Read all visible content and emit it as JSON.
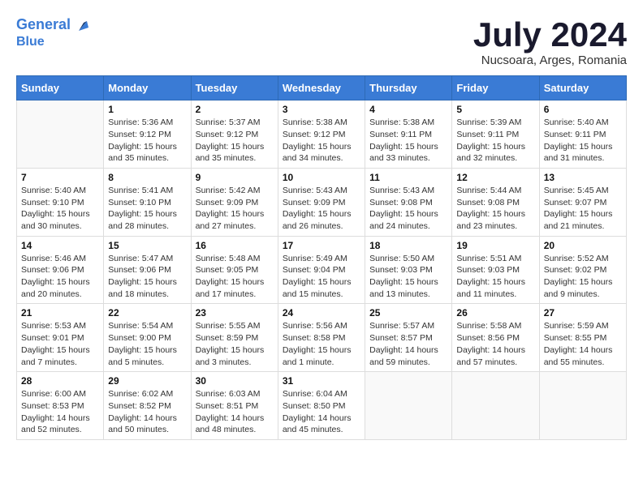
{
  "logo": {
    "line1": "General",
    "line2": "Blue"
  },
  "title": "July 2024",
  "subtitle": "Nucsoara, Arges, Romania",
  "days": [
    "Sunday",
    "Monday",
    "Tuesday",
    "Wednesday",
    "Thursday",
    "Friday",
    "Saturday"
  ],
  "weeks": [
    [
      {
        "day": "",
        "sunrise": "",
        "sunset": "",
        "daylight": ""
      },
      {
        "day": "1",
        "sunrise": "Sunrise: 5:36 AM",
        "sunset": "Sunset: 9:12 PM",
        "daylight": "Daylight: 15 hours and 35 minutes."
      },
      {
        "day": "2",
        "sunrise": "Sunrise: 5:37 AM",
        "sunset": "Sunset: 9:12 PM",
        "daylight": "Daylight: 15 hours and 35 minutes."
      },
      {
        "day": "3",
        "sunrise": "Sunrise: 5:38 AM",
        "sunset": "Sunset: 9:12 PM",
        "daylight": "Daylight: 15 hours and 34 minutes."
      },
      {
        "day": "4",
        "sunrise": "Sunrise: 5:38 AM",
        "sunset": "Sunset: 9:11 PM",
        "daylight": "Daylight: 15 hours and 33 minutes."
      },
      {
        "day": "5",
        "sunrise": "Sunrise: 5:39 AM",
        "sunset": "Sunset: 9:11 PM",
        "daylight": "Daylight: 15 hours and 32 minutes."
      },
      {
        "day": "6",
        "sunrise": "Sunrise: 5:40 AM",
        "sunset": "Sunset: 9:11 PM",
        "daylight": "Daylight: 15 hours and 31 minutes."
      }
    ],
    [
      {
        "day": "7",
        "sunrise": "Sunrise: 5:40 AM",
        "sunset": "Sunset: 9:10 PM",
        "daylight": "Daylight: 15 hours and 30 minutes."
      },
      {
        "day": "8",
        "sunrise": "Sunrise: 5:41 AM",
        "sunset": "Sunset: 9:10 PM",
        "daylight": "Daylight: 15 hours and 28 minutes."
      },
      {
        "day": "9",
        "sunrise": "Sunrise: 5:42 AM",
        "sunset": "Sunset: 9:09 PM",
        "daylight": "Daylight: 15 hours and 27 minutes."
      },
      {
        "day": "10",
        "sunrise": "Sunrise: 5:43 AM",
        "sunset": "Sunset: 9:09 PM",
        "daylight": "Daylight: 15 hours and 26 minutes."
      },
      {
        "day": "11",
        "sunrise": "Sunrise: 5:43 AM",
        "sunset": "Sunset: 9:08 PM",
        "daylight": "Daylight: 15 hours and 24 minutes."
      },
      {
        "day": "12",
        "sunrise": "Sunrise: 5:44 AM",
        "sunset": "Sunset: 9:08 PM",
        "daylight": "Daylight: 15 hours and 23 minutes."
      },
      {
        "day": "13",
        "sunrise": "Sunrise: 5:45 AM",
        "sunset": "Sunset: 9:07 PM",
        "daylight": "Daylight: 15 hours and 21 minutes."
      }
    ],
    [
      {
        "day": "14",
        "sunrise": "Sunrise: 5:46 AM",
        "sunset": "Sunset: 9:06 PM",
        "daylight": "Daylight: 15 hours and 20 minutes."
      },
      {
        "day": "15",
        "sunrise": "Sunrise: 5:47 AM",
        "sunset": "Sunset: 9:06 PM",
        "daylight": "Daylight: 15 hours and 18 minutes."
      },
      {
        "day": "16",
        "sunrise": "Sunrise: 5:48 AM",
        "sunset": "Sunset: 9:05 PM",
        "daylight": "Daylight: 15 hours and 17 minutes."
      },
      {
        "day": "17",
        "sunrise": "Sunrise: 5:49 AM",
        "sunset": "Sunset: 9:04 PM",
        "daylight": "Daylight: 15 hours and 15 minutes."
      },
      {
        "day": "18",
        "sunrise": "Sunrise: 5:50 AM",
        "sunset": "Sunset: 9:03 PM",
        "daylight": "Daylight: 15 hours and 13 minutes."
      },
      {
        "day": "19",
        "sunrise": "Sunrise: 5:51 AM",
        "sunset": "Sunset: 9:03 PM",
        "daylight": "Daylight: 15 hours and 11 minutes."
      },
      {
        "day": "20",
        "sunrise": "Sunrise: 5:52 AM",
        "sunset": "Sunset: 9:02 PM",
        "daylight": "Daylight: 15 hours and 9 minutes."
      }
    ],
    [
      {
        "day": "21",
        "sunrise": "Sunrise: 5:53 AM",
        "sunset": "Sunset: 9:01 PM",
        "daylight": "Daylight: 15 hours and 7 minutes."
      },
      {
        "day": "22",
        "sunrise": "Sunrise: 5:54 AM",
        "sunset": "Sunset: 9:00 PM",
        "daylight": "Daylight: 15 hours and 5 minutes."
      },
      {
        "day": "23",
        "sunrise": "Sunrise: 5:55 AM",
        "sunset": "Sunset: 8:59 PM",
        "daylight": "Daylight: 15 hours and 3 minutes."
      },
      {
        "day": "24",
        "sunrise": "Sunrise: 5:56 AM",
        "sunset": "Sunset: 8:58 PM",
        "daylight": "Daylight: 15 hours and 1 minute."
      },
      {
        "day": "25",
        "sunrise": "Sunrise: 5:57 AM",
        "sunset": "Sunset: 8:57 PM",
        "daylight": "Daylight: 14 hours and 59 minutes."
      },
      {
        "day": "26",
        "sunrise": "Sunrise: 5:58 AM",
        "sunset": "Sunset: 8:56 PM",
        "daylight": "Daylight: 14 hours and 57 minutes."
      },
      {
        "day": "27",
        "sunrise": "Sunrise: 5:59 AM",
        "sunset": "Sunset: 8:55 PM",
        "daylight": "Daylight: 14 hours and 55 minutes."
      }
    ],
    [
      {
        "day": "28",
        "sunrise": "Sunrise: 6:00 AM",
        "sunset": "Sunset: 8:53 PM",
        "daylight": "Daylight: 14 hours and 52 minutes."
      },
      {
        "day": "29",
        "sunrise": "Sunrise: 6:02 AM",
        "sunset": "Sunset: 8:52 PM",
        "daylight": "Daylight: 14 hours and 50 minutes."
      },
      {
        "day": "30",
        "sunrise": "Sunrise: 6:03 AM",
        "sunset": "Sunset: 8:51 PM",
        "daylight": "Daylight: 14 hours and 48 minutes."
      },
      {
        "day": "31",
        "sunrise": "Sunrise: 6:04 AM",
        "sunset": "Sunset: 8:50 PM",
        "daylight": "Daylight: 14 hours and 45 minutes."
      },
      {
        "day": "",
        "sunrise": "",
        "sunset": "",
        "daylight": ""
      },
      {
        "day": "",
        "sunrise": "",
        "sunset": "",
        "daylight": ""
      },
      {
        "day": "",
        "sunrise": "",
        "sunset": "",
        "daylight": ""
      }
    ]
  ]
}
